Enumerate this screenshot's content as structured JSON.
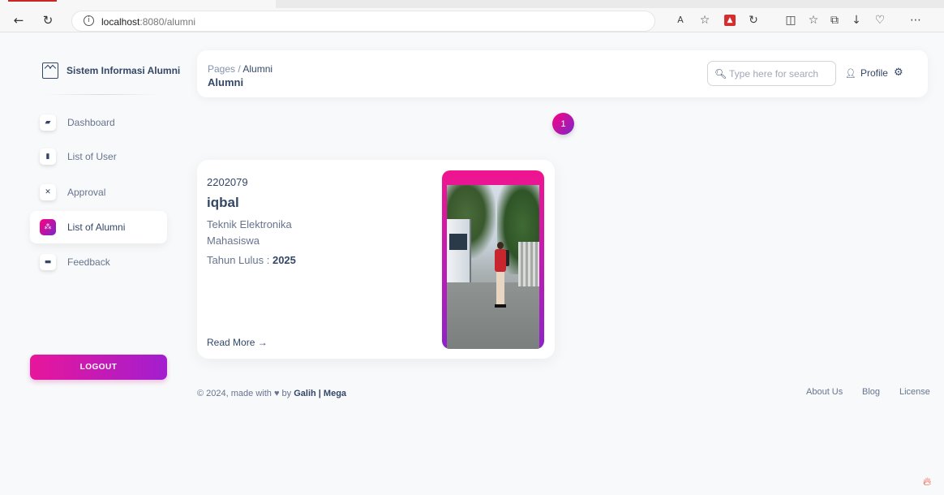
{
  "browser": {
    "url_host": "localhost",
    "url_rest": ":8080/alumni"
  },
  "sidebar": {
    "brand": "Sistem Informasi Alumni",
    "items": [
      {
        "label": "Dashboard",
        "icon": "shop-icon"
      },
      {
        "label": "List of User",
        "icon": "users-icon"
      },
      {
        "label": "Approval",
        "icon": "tools-icon"
      },
      {
        "label": "List of Alumni",
        "icon": "alumni-icon",
        "active": true
      },
      {
        "label": "Feedback",
        "icon": "card-icon"
      }
    ],
    "logout": "LOGOUT"
  },
  "navbar": {
    "breadcrumb_root": "Pages",
    "breadcrumb_sep": "/",
    "breadcrumb_current": "Alumni",
    "title": "Alumni",
    "search_placeholder": "Type here for search",
    "profile": "Profile"
  },
  "pagination": {
    "current_page": "1"
  },
  "alumni_cards": [
    {
      "nim": "2202079",
      "name": "iqbal",
      "jurusan": "Teknik Elektronika",
      "status": "Mahasiswa",
      "lulus_label": "Tahun Lulus :",
      "lulus_year": "2025",
      "read_more": "Read More"
    }
  ],
  "footer": {
    "prefix": "© 2024, made with",
    "by": "by",
    "authors": "Galih | Mega",
    "links": [
      "About Us",
      "Blog",
      "License"
    ]
  },
  "colors": {
    "accent_start": "#ff0080",
    "accent_end": "#7928ca",
    "text_primary": "#344767",
    "text_secondary": "#67748e"
  }
}
